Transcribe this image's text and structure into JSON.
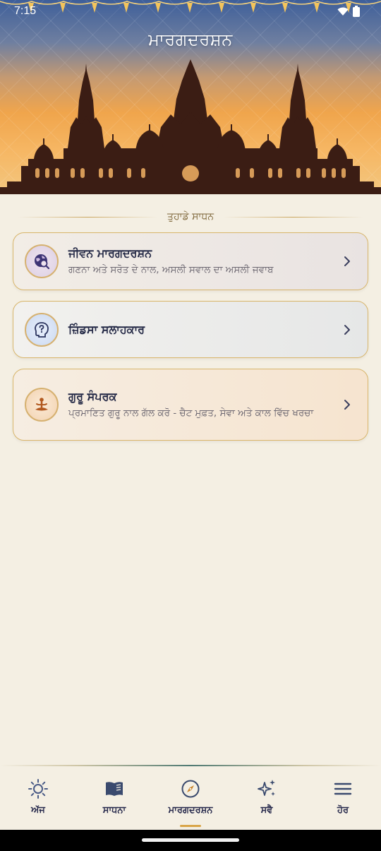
{
  "status_bar": {
    "time": "7:15"
  },
  "header": {
    "title": "ਮਾਰਗਦਰਸ਼ਨ"
  },
  "section": {
    "label": "ਤੁਹਾਡੇ ਸਾਧਨ"
  },
  "cards": [
    {
      "title": "ਜੀਵਨ ਮਾਰਗਦਰਸ਼ਨ",
      "subtitle": "ਗਣਨਾ ਅਤੇ ਸਰੋਤ ਦੇ ਨਾਲ, ਅਸਲੀ ਸਵਾਲ ਦਾ ਅਸਲੀ ਜਵਾਬ",
      "icon": "globe-search-icon"
    },
    {
      "title": "ਜ਼ਿੰਡਸਾ ਸਲਾਹਕਾਰ",
      "icon": "head-question-icon"
    },
    {
      "title": "ਗੁਰੂ ਸੰਪਰਕ",
      "subtitle": "ਪ੍ਰਮਾਣਿਤ ਗੁਰੂ ਨਾਲ ਗੱਲ ਕਰੋ - ਚੈਟ ਮੁਫ਼ਤ, ਸੇਵਾ ਅਤੇ ਕਾਲ ਵਿੱਚ ਖਰਚਾ",
      "icon": "meditation-icon"
    }
  ],
  "nav": {
    "items": [
      {
        "label": "ਅੱਜ",
        "icon": "sun-icon"
      },
      {
        "label": "ਸਾਧਨਾ",
        "icon": "book-icon"
      },
      {
        "label": "ਮਾਰਗਦਰਸ਼ਨ",
        "icon": "compass-icon",
        "active": true
      },
      {
        "label": "ਸਵੈ",
        "icon": "sparkles-icon"
      },
      {
        "label": "ਹੋਰ",
        "icon": "menu-icon"
      }
    ]
  },
  "colors": {
    "accent_gold": "#d9a548",
    "nav_text": "#24274a",
    "background": "#f4efe3"
  }
}
